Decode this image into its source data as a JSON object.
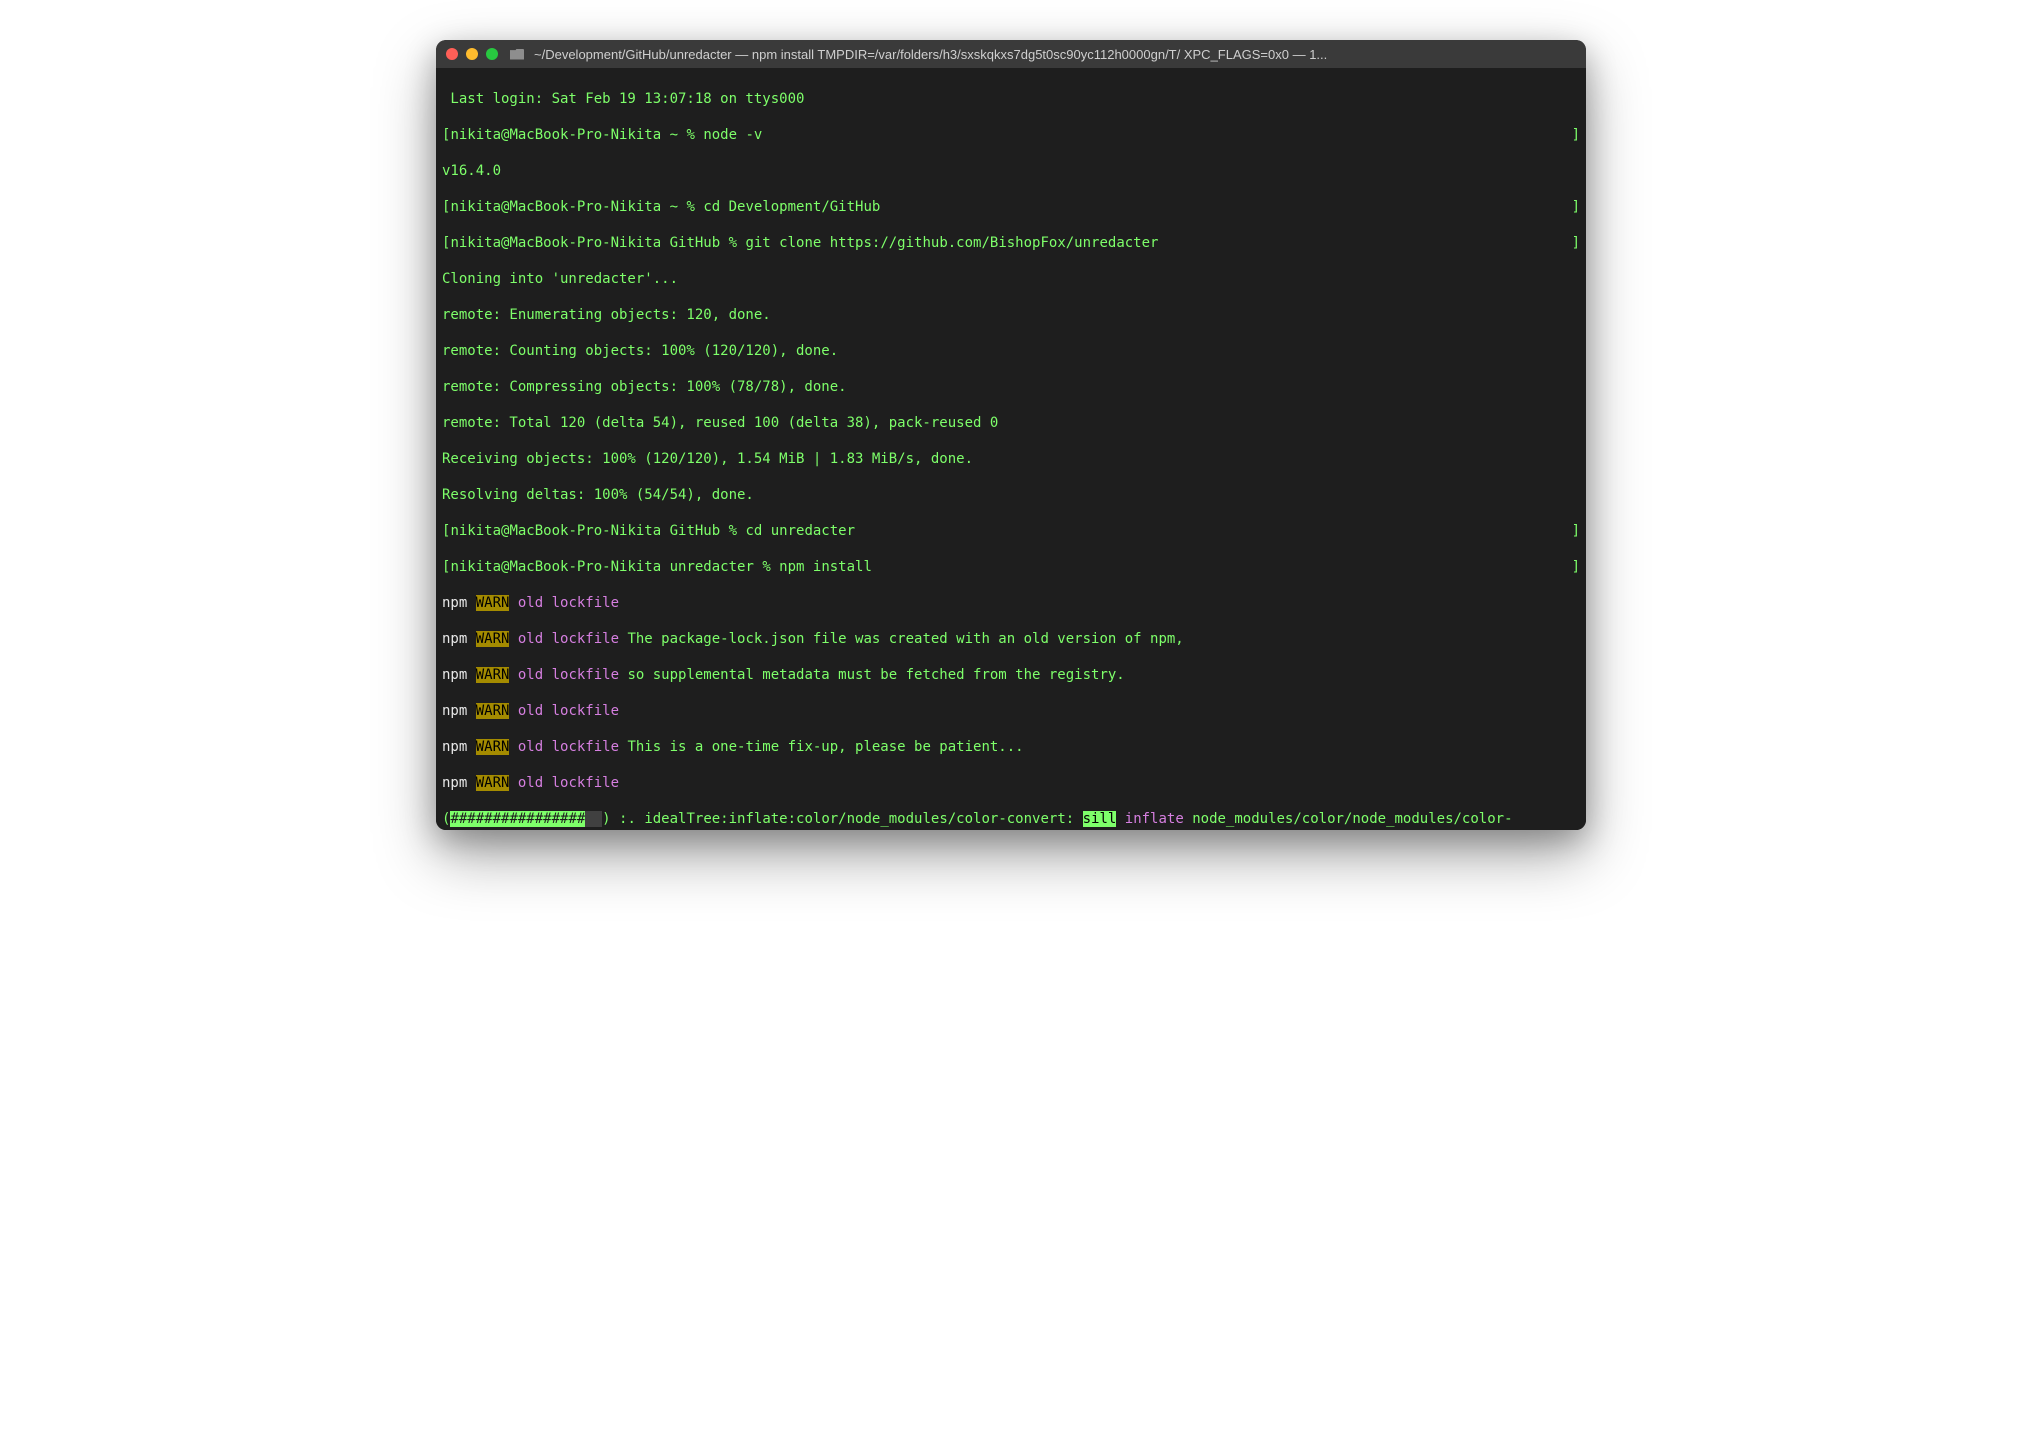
{
  "window": {
    "title": "~/Development/GitHub/unredacter — npm install TMPDIR=/var/folders/h3/sxskqkxs7dg5t0sc90yc112h0000gn/T/ XPC_FLAGS=0x0 — 1..."
  },
  "last_login": " Last login: Sat Feb 19 13:07:18 on ttys000",
  "p1_open": "[",
  "p1_user": "nikita@MacBook-Pro-Nikita",
  "p1_path": " ~ ",
  "p1_sym": "% ",
  "p1_cmd": "node -v",
  "p1_close": "]",
  "node_version": "v16.4.0",
  "p2_open": "[",
  "p2_user": "nikita@MacBook-Pro-Nikita",
  "p2_path": " ~ ",
  "p2_sym": "% ",
  "p2_cmd": "cd Development/GitHub",
  "p2_close": "]",
  "p3_open": "[",
  "p3_user": "nikita@MacBook-Pro-Nikita",
  "p3_path": " GitHub ",
  "p3_sym": "% ",
  "p3_cmd": "git clone https://github.com/BishopFox/unredacter",
  "p3_close": "]",
  "clone_line": "Cloning into 'unredacter'...",
  "r1": "remote: Enumerating objects: 120, done.",
  "r2": "remote: Counting objects: 100% (120/120), done.",
  "r3": "remote: Compressing objects: 100% (78/78), done.",
  "r4": "remote: Total 120 (delta 54), reused 100 (delta 38), pack-reused 0",
  "r5": "Receiving objects: 100% (120/120), 1.54 MiB | 1.83 MiB/s, done.",
  "r6": "Resolving deltas: 100% (54/54), done.",
  "p4_open": "[",
  "p4_user": "nikita@MacBook-Pro-Nikita",
  "p4_path": " GitHub ",
  "p4_sym": "% ",
  "p4_cmd": "cd unredacter",
  "p4_close": "]",
  "p5_open": "[",
  "p5_user": "nikita@MacBook-Pro-Nikita",
  "p5_path": " unredacter ",
  "p5_sym": "% ",
  "p5_cmd": "npm install",
  "p5_close": "]",
  "npm_label": "npm ",
  "warn_tag": "WARN",
  "old_lockfile": " old lockfile",
  "wmsg1": " ",
  "wmsg2": " The package-lock.json file was created with an old version of npm,",
  "wmsg3": " so supplemental metadata must be fetched from the registry.",
  "wmsg4": " ",
  "wmsg5": " This is a one-time fix-up, please be patient...",
  "wmsg6": " ",
  "pb_open": "(",
  "pb_fill": "################",
  "pb_shade": "##",
  "pb_close": ") ",
  "pb_spinner": ":. ",
  "idealtree": "idealTree:inflate:color/node_modules/color-convert: ",
  "sill_tag": "sill",
  "sill_space": " ",
  "inflate_word": "inflate",
  "inflate_path": " node_modules/color/node_modules/color-"
}
